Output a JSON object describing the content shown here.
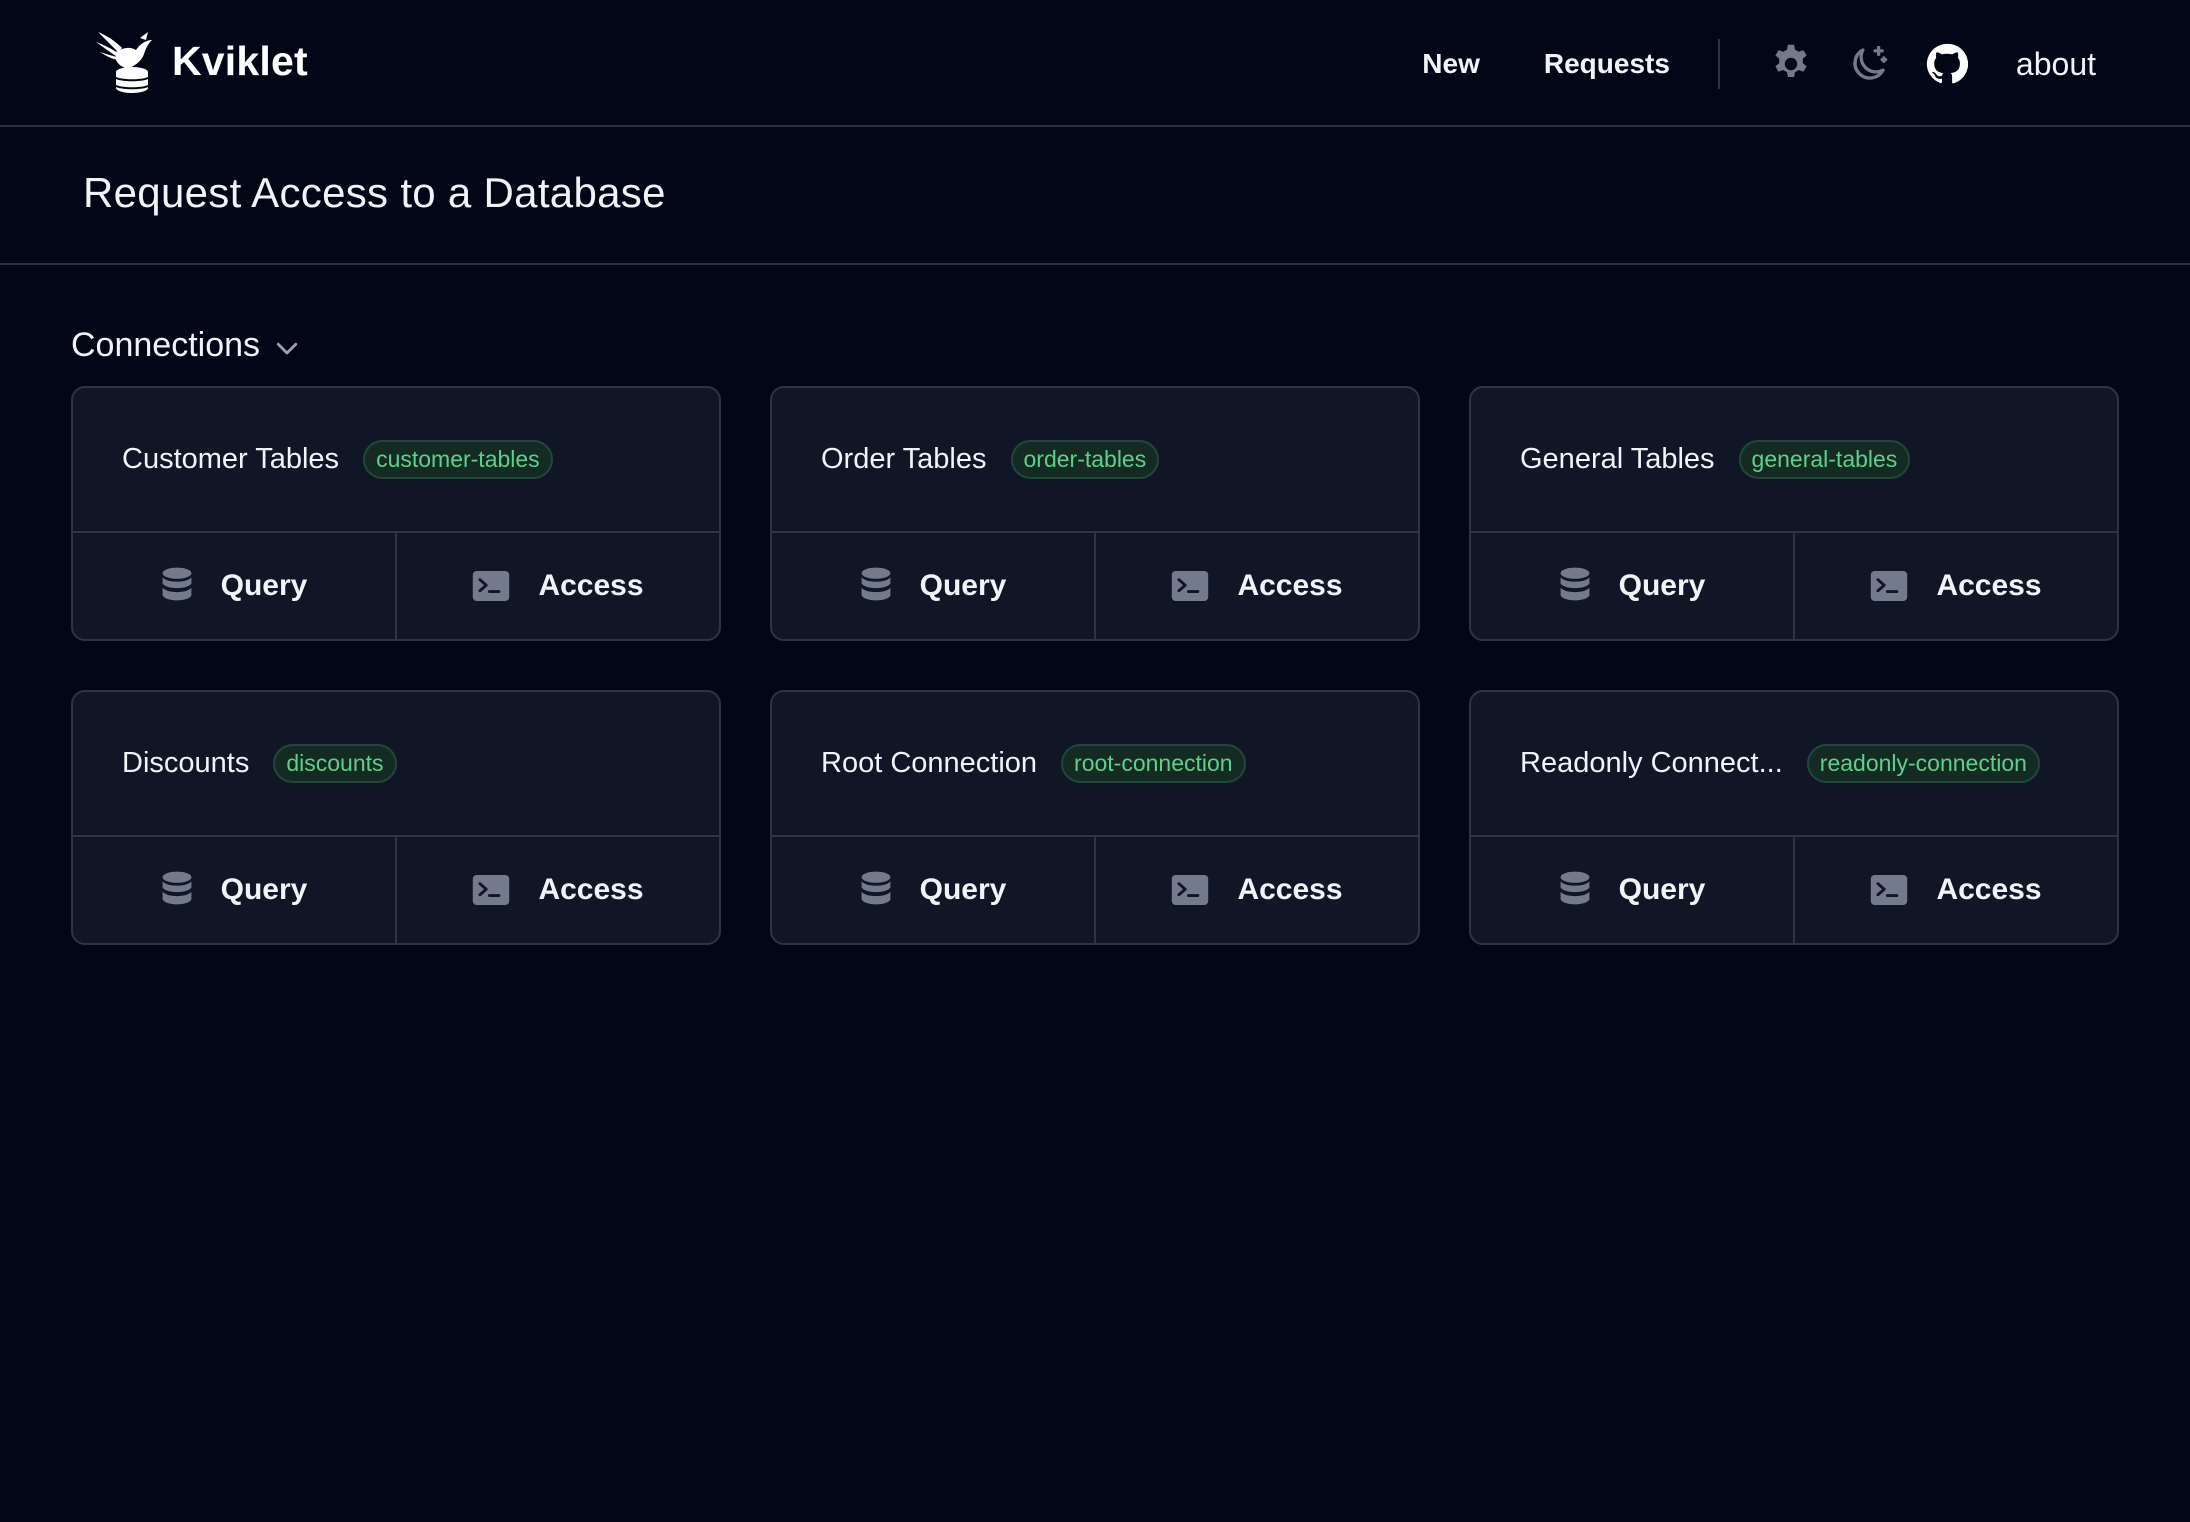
{
  "app": {
    "name": "Kviklet",
    "logo_icon": "kviklet-bird-logo-icon"
  },
  "nav": {
    "new_label": "New",
    "requests_label": "Requests",
    "settings_icon": "gear-icon",
    "theme_icon": "moon-icon",
    "github_icon": "github-icon",
    "about_label": "about"
  },
  "page": {
    "title": "Request Access to a Database"
  },
  "connections": {
    "header": "Connections",
    "header_icon": "chevron-down-icon",
    "query_label": "Query",
    "access_label": "Access",
    "query_icon": "database-icon",
    "access_icon": "terminal-icon",
    "items": [
      {
        "name": "Customer Tables",
        "tag": "customer-tables"
      },
      {
        "name": "Order Tables",
        "tag": "order-tables"
      },
      {
        "name": "General Tables",
        "tag": "general-tables"
      },
      {
        "name": "Discounts",
        "tag": "discounts"
      },
      {
        "name": "Root Connection",
        "tag": "root-connection"
      },
      {
        "name": "Readonly Connect...",
        "tag": "readonly-connection"
      }
    ]
  },
  "colors": {
    "background": "#030616",
    "card_background": "#111627",
    "border": "#2e3443",
    "tag_text": "#5fd08b",
    "tag_background": "#142b23",
    "icon_gray": "#727a8c"
  }
}
